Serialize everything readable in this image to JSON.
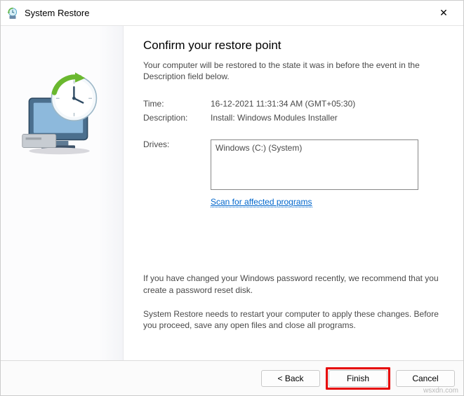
{
  "window": {
    "title": "System Restore"
  },
  "heading": "Confirm your restore point",
  "subtitle": "Your computer will be restored to the state it was in before the event in the Description field below.",
  "labels": {
    "time": "Time:",
    "description": "Description:",
    "drives": "Drives:"
  },
  "values": {
    "time": "16-12-2021 11:31:34 AM (GMT+05:30)",
    "description": "Install: Windows Modules Installer",
    "drives": "Windows (C:) (System)"
  },
  "scan_link": "Scan for affected programs",
  "note1": "If you have changed your Windows password recently, we recommend that you create a password reset disk.",
  "note2": "System Restore needs to restart your computer to apply these changes. Before you proceed, save any open files and close all programs.",
  "buttons": {
    "back": "< Back",
    "finish": "Finish",
    "cancel": "Cancel"
  },
  "watermark": "wsxdn.com"
}
